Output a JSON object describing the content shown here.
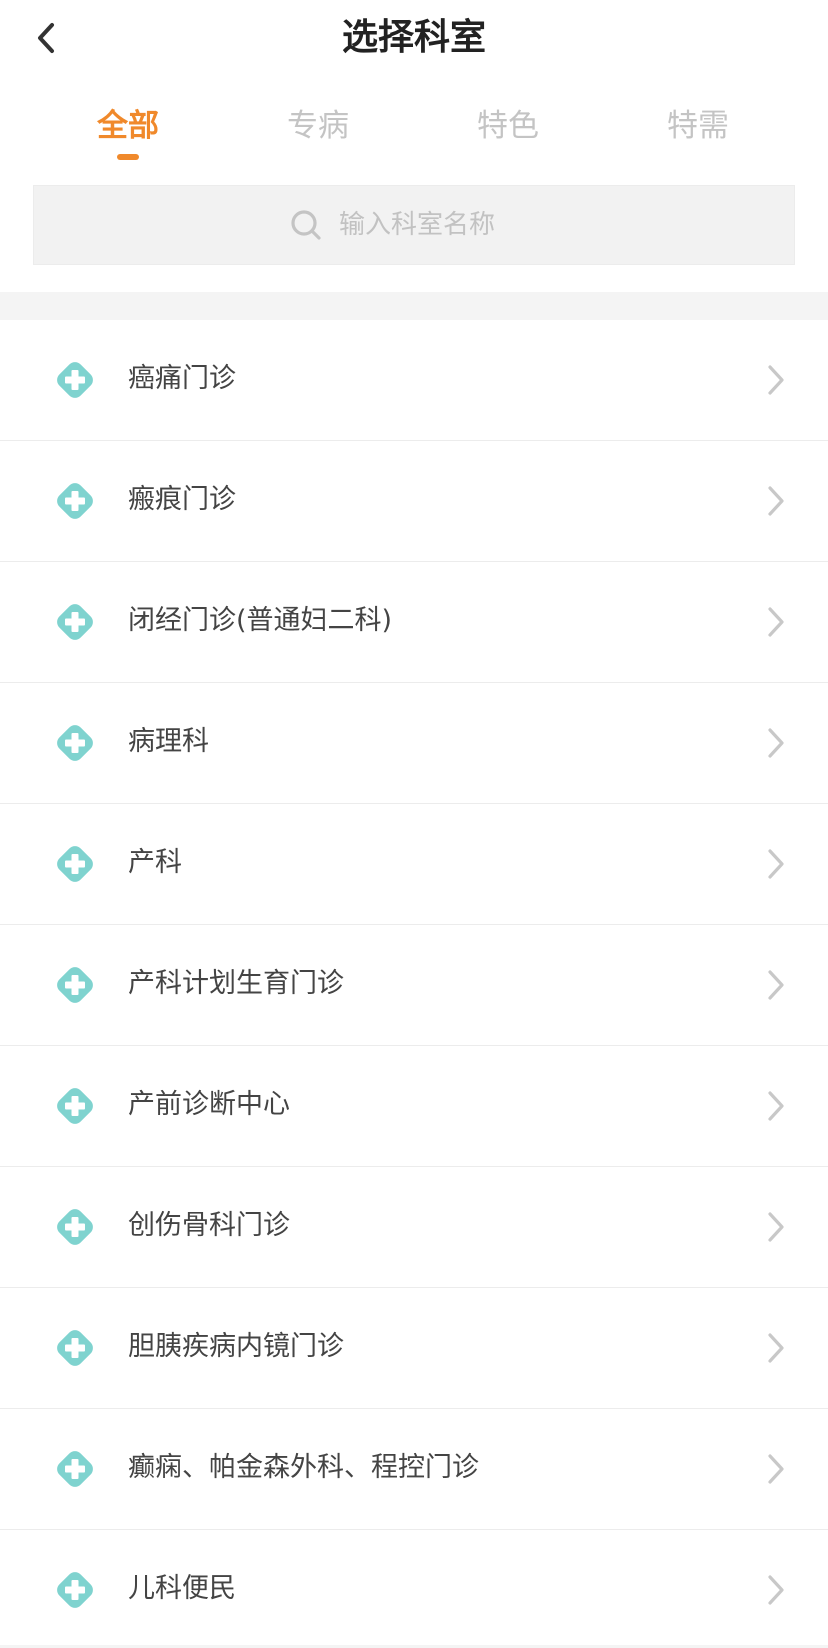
{
  "header": {
    "title": "选择科室",
    "back_icon": "chevron-left-icon"
  },
  "tabs": [
    {
      "label": "全部",
      "active": true
    },
    {
      "label": "专病",
      "active": false
    },
    {
      "label": "特色",
      "active": false
    },
    {
      "label": "特需",
      "active": false
    }
  ],
  "search": {
    "placeholder": "输入科室名称",
    "value": "",
    "icon": "search-icon"
  },
  "colors": {
    "accent": "#f0892b",
    "icon_teal": "#7fd3cf",
    "chevron": "#c8c8c8"
  },
  "departments": [
    {
      "name": "癌痛门诊"
    },
    {
      "name": "瘢痕门诊"
    },
    {
      "name": "闭经门诊(普通妇二科)"
    },
    {
      "name": "病理科"
    },
    {
      "name": "产科"
    },
    {
      "name": "产科计划生育门诊"
    },
    {
      "name": "产前诊断中心"
    },
    {
      "name": "创伤骨科门诊"
    },
    {
      "name": "胆胰疾病内镜门诊"
    },
    {
      "name": "癫痫、帕金森外科、程控门诊"
    },
    {
      "name": "儿科便民"
    }
  ]
}
